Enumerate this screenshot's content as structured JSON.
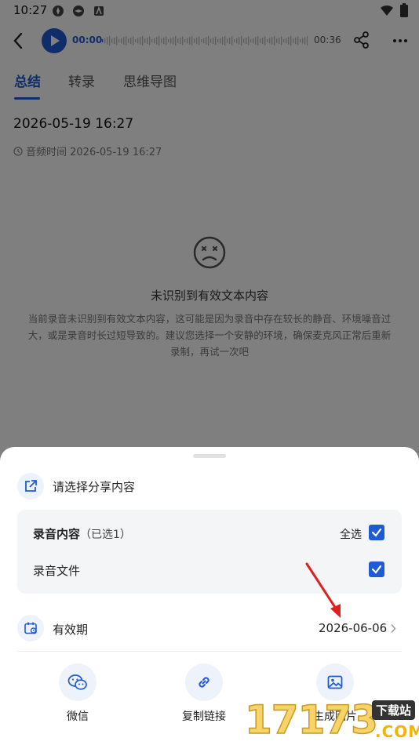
{
  "status_bar": {
    "time": "10:27"
  },
  "player": {
    "current_time": "00:00",
    "total_time": "00:36"
  },
  "tabs": [
    {
      "label": "总结",
      "active": true
    },
    {
      "label": "转录",
      "active": false
    },
    {
      "label": "思维导图",
      "active": false
    }
  ],
  "recording": {
    "title": "2026-05-19 16:27",
    "audio_time": "音频时间 2026-05-19 16:27"
  },
  "empty_state": {
    "title": "未识别到有效文本内容",
    "description": "当前录音未识别到有效文本内容，这可能是因为录音中存在较长的静音、环境噪音过大，或是录音时长过短导致的。建议您选择一个安静的环境，确保麦克风正常后重新录制，再试一次吧"
  },
  "share_sheet": {
    "header": "请选择分享内容",
    "content_section": {
      "title": "录音内容",
      "count": "（已选1）",
      "select_all_label": "全选",
      "select_all_checked": true,
      "items": [
        {
          "label": "录音文件",
          "checked": true
        }
      ]
    },
    "validity": {
      "label": "有效期",
      "value": "2026-06-06"
    },
    "share_options": [
      {
        "label": "微信",
        "icon": "wechat-icon"
      },
      {
        "label": "复制链接",
        "icon": "link-icon"
      },
      {
        "label": "生成图片",
        "icon": "image-icon"
      }
    ]
  },
  "watermark": {
    "digits": "17173",
    "tag": "下载站",
    "domain": ".COM"
  },
  "colors": {
    "accent": "#1f5bd4",
    "overlay": "rgba(0,0,0,0.5)",
    "annotation_arrow": "#e02020"
  }
}
